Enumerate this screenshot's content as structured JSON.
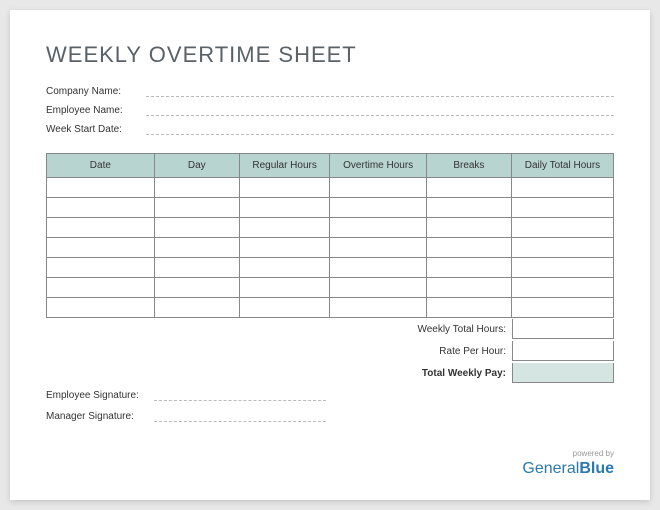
{
  "title": "WEEKLY OVERTIME SHEET",
  "info": {
    "company_label": "Company Name:",
    "employee_label": "Employee Name:",
    "week_start_label": "Week Start Date:"
  },
  "table": {
    "headers": {
      "date": "Date",
      "day": "Day",
      "regular": "Regular Hours",
      "overtime": "Overtime Hours",
      "breaks": "Breaks",
      "daily_total": "Daily Total Hours"
    },
    "row_count": 7
  },
  "summary": {
    "weekly_total_label": "Weekly Total Hours:",
    "rate_label": "Rate Per Hour:",
    "total_pay_label": "Total Weekly Pay:"
  },
  "signatures": {
    "employee_label": "Employee Signature:",
    "manager_label": "Manager Signature:"
  },
  "footer": {
    "powered_by": "powered by",
    "logo_part1": "General",
    "logo_part2": "Blue"
  }
}
